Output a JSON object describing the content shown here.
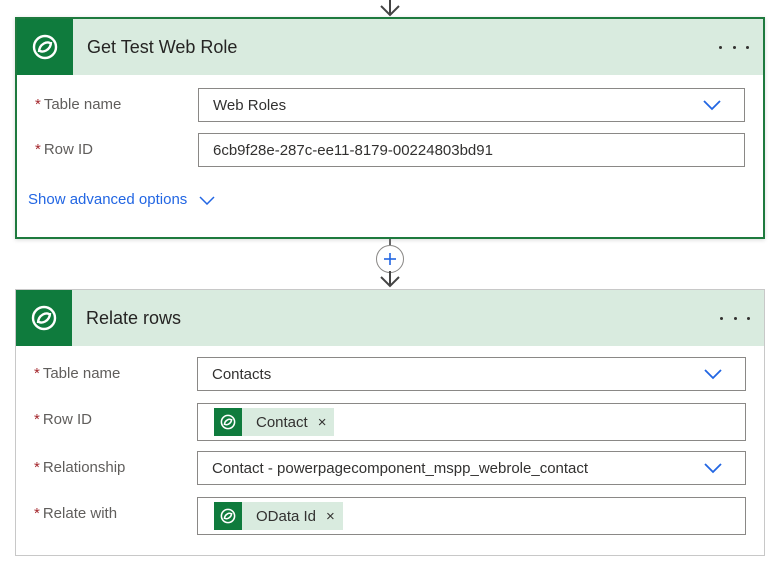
{
  "cards": [
    {
      "title": "Get Test Web Role",
      "fields": [
        {
          "label": "Table name",
          "value": "Web Roles",
          "type": "dropdown"
        },
        {
          "label": "Row ID",
          "value": "6cb9f28e-287c-ee11-8179-00224803bd91",
          "type": "text"
        }
      ],
      "advanced_label": "Show advanced options"
    },
    {
      "title": "Relate rows",
      "fields": [
        {
          "label": "Table name",
          "value": "Contacts",
          "type": "dropdown"
        },
        {
          "label": "Row ID",
          "token": "Contact",
          "type": "token"
        },
        {
          "label": "Relationship",
          "value": "Contact - powerpagecomponent_mspp_webrole_contact",
          "type": "dropdown"
        },
        {
          "label": "Relate with",
          "token": "OData Id",
          "type": "token"
        }
      ]
    }
  ],
  "required_marker": "*",
  "token_close": "×",
  "more_icon": "ellipsis-icon",
  "colors": {
    "brand_green": "#0f7b3d",
    "header_bg": "#d9ebdf",
    "link_blue": "#2266e3",
    "required_red": "#a4262c"
  }
}
